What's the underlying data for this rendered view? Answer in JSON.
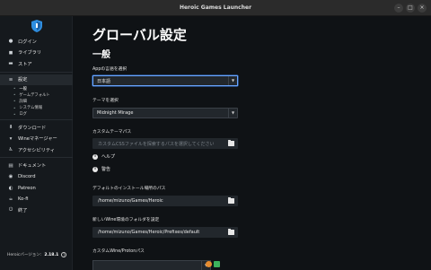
{
  "window": {
    "title": "Heroic Games Launcher"
  },
  "sidebar": {
    "items": [
      {
        "icon": "user-icon",
        "glyph": "●",
        "label": "ログイン"
      },
      {
        "icon": "gamepad-icon",
        "glyph": "◼",
        "label": "ライブラリ"
      },
      {
        "icon": "store-icon",
        "glyph": "▬",
        "label": "ストア"
      }
    ],
    "settings": {
      "icon": "sliders-icon",
      "glyph": "≡",
      "label": "設定",
      "subitems": [
        "一般",
        "ゲームデフォルト",
        "詳細",
        "システム情報",
        "ログ"
      ]
    },
    "items2": [
      {
        "icon": "download-icon",
        "glyph": "⬇",
        "label": "ダウンロード"
      },
      {
        "icon": "wine-icon",
        "glyph": "▾",
        "label": "Wineマネージャー"
      },
      {
        "icon": "accessibility-icon",
        "glyph": "♿",
        "label": "アクセシビリティ"
      }
    ],
    "items3": [
      {
        "icon": "book-icon",
        "glyph": "▤",
        "label": "ドキュメント"
      },
      {
        "icon": "discord-icon",
        "glyph": "◉",
        "label": "Discord"
      },
      {
        "icon": "patreon-icon",
        "glyph": "◐",
        "label": "Patreon"
      },
      {
        "icon": "kofi-icon",
        "glyph": "☕",
        "label": "Ko-fi"
      },
      {
        "icon": "quit-icon",
        "glyph": "⏻",
        "label": "終了"
      }
    ],
    "version_label": "Heroicバージョン:",
    "version_value": "2.18.1"
  },
  "main": {
    "page_title": "グローバル設定",
    "section_title": "一般",
    "language": {
      "label": "Appの言語を選択",
      "value": "日本語"
    },
    "theme": {
      "label": "テーマを選択",
      "value": "Midnight Mirage"
    },
    "custom_theme": {
      "label": "カスタムテーマパス",
      "placeholder": "カスタムCSSファイルを探索するパスを選択してください",
      "help_label": "ヘルプ",
      "warning_label": "警告"
    },
    "install_path": {
      "label": "デフォルトのインストール場所のパス",
      "value": "/home/mizuno/Games/Heroic"
    },
    "wine_prefix": {
      "label": "新しいWine環境のフォルダを設定",
      "value": "/home/mizuno/Games/Heroic/Prefixes/default"
    },
    "custom_wine": {
      "label": "カスタムWine/Protonパス"
    }
  },
  "colors": {
    "accent": "#6aa6ff",
    "sidebar_bg": "#15191d",
    "main_bg": "#0f1215",
    "field_bg": "#22272c"
  }
}
